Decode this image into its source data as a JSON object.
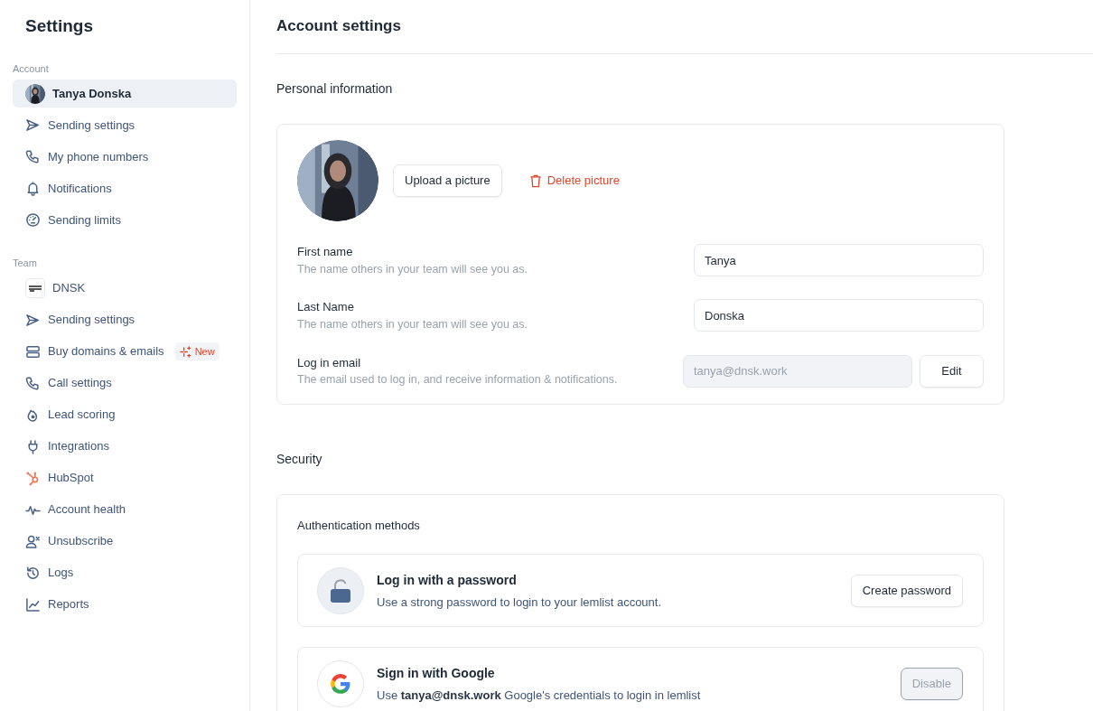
{
  "sidebar": {
    "title": "Settings",
    "sections": [
      {
        "label": "Account",
        "items": [
          {
            "kind": "avatar",
            "label": "Tanya Donska",
            "selected": true
          },
          {
            "kind": "send",
            "label": "Sending settings",
            "selected": false
          },
          {
            "kind": "phone",
            "label": "My phone numbers",
            "selected": false
          },
          {
            "kind": "bell",
            "label": "Notifications",
            "selected": false
          },
          {
            "kind": "gauge",
            "label": "Sending limits",
            "selected": false
          }
        ]
      },
      {
        "label": "Team",
        "items": [
          {
            "kind": "logo",
            "label": "DNSK",
            "selected": false
          },
          {
            "kind": "send",
            "label": "Sending settings",
            "selected": false
          },
          {
            "kind": "server",
            "label": "Buy domains & emails",
            "selected": false,
            "badge": "New"
          },
          {
            "kind": "phone",
            "label": "Call settings",
            "selected": false
          },
          {
            "kind": "flame",
            "label": "Lead scoring",
            "selected": false
          },
          {
            "kind": "plug",
            "label": "Integrations",
            "selected": false
          },
          {
            "kind": "hub",
            "label": "HubSpot",
            "selected": false
          },
          {
            "kind": "pulse",
            "label": "Account health",
            "selected": false
          },
          {
            "kind": "userx",
            "label": "Unsubscribe",
            "selected": false
          },
          {
            "kind": "history",
            "label": "Logs",
            "selected": false
          },
          {
            "kind": "chart",
            "label": "Reports",
            "selected": false
          }
        ]
      }
    ]
  },
  "header": {
    "title": "Account settings"
  },
  "personal": {
    "title": "Personal information",
    "upload_button": "Upload a picture",
    "delete_button": "Delete picture",
    "fields": [
      {
        "label": "First name",
        "hint": "The name others in your team will see you as.",
        "value": "Tanya",
        "disabled": false
      },
      {
        "label": "Last Name",
        "hint": "The name others in your team will see you as.",
        "value": "Donska",
        "disabled": false
      },
      {
        "label": "Log in email",
        "hint": "The email used to log in, and receive information & notifications.",
        "value": "tanya@dnsk.work",
        "disabled": true,
        "button": "Edit"
      }
    ]
  },
  "security": {
    "title": "Security",
    "subtitle": "Authentication methods",
    "methods": [
      {
        "kind": "password",
        "title": "Log in with a password",
        "description": "Use a strong password to login to your lemlist account.",
        "button": "Create password",
        "disabled": false
      },
      {
        "kind": "google",
        "title": "Sign in with Google",
        "description": "Use **tanya@dnsk.work** Google's credentials to login in lemlist",
        "button": "Disable",
        "disabled": true
      }
    ]
  }
}
